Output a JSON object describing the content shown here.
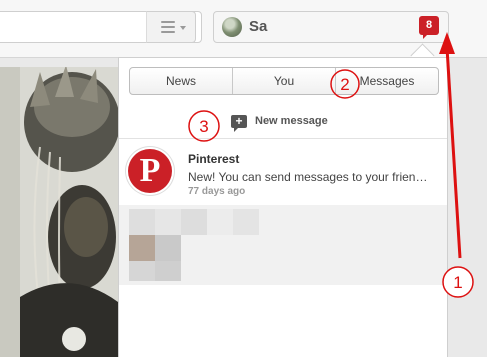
{
  "header": {
    "username": "Sa",
    "notification_count": "8"
  },
  "panel": {
    "tabs": [
      {
        "label": "News"
      },
      {
        "label": "You"
      },
      {
        "label": "Messages"
      }
    ],
    "new_message_label": "New message",
    "conversation": {
      "sender": "Pinterest",
      "preview": "New! You can send messages to your frien…",
      "time": "77 days ago"
    }
  },
  "annotations": {
    "labels": [
      "1",
      "2",
      "3"
    ]
  },
  "colors": {
    "brand_red": "#cb2027",
    "annotation_red": "#dd1111"
  }
}
